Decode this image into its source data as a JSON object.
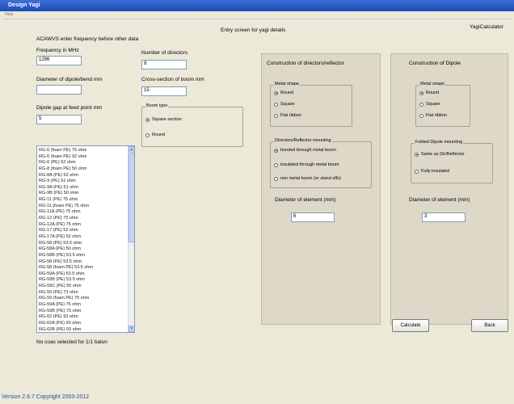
{
  "window": {
    "title": "Design Yagi",
    "menu": "Help"
  },
  "header": {
    "entry_screen": "Entry screen for yagi details",
    "app_name": "YagiCalculator",
    "note": "ACAWVS enter frequency before other data"
  },
  "fields": {
    "frequency": {
      "label": "Frequency in MHz",
      "value": "1296"
    },
    "diameter_dipole": {
      "label": "Diameter of dipole/bend mm",
      "value": ""
    },
    "dipole_gap": {
      "label": "Dipole gap at feed point mm",
      "value": "5"
    },
    "num_directors": {
      "label": "Number of directors",
      "value": "8"
    },
    "boom_cross_section": {
      "label": "Cross-section of boom mm",
      "value": "15"
    }
  },
  "boom_type": {
    "title": "Boom type",
    "options": [
      {
        "label": "Square section",
        "selected": true
      },
      {
        "label": "Round",
        "selected": false
      }
    ]
  },
  "cable_list": {
    "items": [
      "RG-6 (foam PE) 75 ohm",
      "RG-6 (foam PE) 92 ohm",
      "RG-6 (PE) 52 ohm",
      "RG-8 (foam PE) 50 ohm",
      "RG-8A (PE) 52 ohm",
      "RG-9 (PE) 51 ohm",
      "RG-9A (PE) 51 ohm",
      "RG-9B (PE) 50 ohm",
      "RG-11 (PE) 75 ohm",
      "RG-11 (foam PE) 75 ohm",
      "RG-11A (PE) 75 ohm",
      "RG-12 (PE) 75 ohm",
      "RG-12A (PE) 75 ohm",
      "RG-17 (PE) 52 ohm",
      "RG-17A (PE) 52 ohm",
      "RG-58 (PE) 53.5 ohm",
      "RG-58A (PE) 50 ohm",
      "RG-58B (PE) 53.5 ohm",
      "RG-58 (PE) 53.5 ohm",
      "RG-58 (foam PE) 53.5 ohm",
      "RG-59A (PE) 53.5 ohm",
      "RG-59B (PE) 53.5 ohm",
      "RG-59C (PE) 50 ohm",
      "RG-59 (PE) 73 ohm",
      "RG-59 (foam PE) 75 ohm",
      "RG-59A (PE) 75 ohm",
      "RG-59B (PE) 75 ohm",
      "RG-62 (PE) 93 ohm",
      "RG-62A (PE) 93 ohm",
      "RG-62B (PE) 93 ohm"
    ],
    "status": "No coax selected for 1/1 balun"
  },
  "directors_panel": {
    "title": "Construction of directors/reflector",
    "metal_shape": {
      "title": "Metal shape",
      "options": [
        {
          "label": "Round",
          "selected": true
        },
        {
          "label": "Square",
          "selected": false
        },
        {
          "label": "Flat ribbon",
          "selected": false
        }
      ]
    },
    "mounting": {
      "title": "Directors/Reflector mounting",
      "options": [
        {
          "label": "bonded through metal boom",
          "selected": true
        },
        {
          "label": "insulated through metal boom",
          "selected": false
        },
        {
          "label": "non metal boom (or stand offs)",
          "selected": false
        }
      ]
    },
    "diameter": {
      "label": "Diameter of element (mm)",
      "value": "6"
    }
  },
  "dipole_panel": {
    "title": "Construction of Dipole",
    "metal_shape": {
      "title": "Metal shape",
      "options": [
        {
          "label": "Round",
          "selected": true
        },
        {
          "label": "Square",
          "selected": false
        },
        {
          "label": "Flat ribbon",
          "selected": false
        }
      ]
    },
    "mounting": {
      "title": "Folded Dipole mounting",
      "options": [
        {
          "label": "Same as Dir/Reflector",
          "selected": true
        },
        {
          "label": "Fully insulated",
          "selected": false
        }
      ]
    },
    "diameter": {
      "label": "Diameter of element (mm)",
      "value": "3"
    }
  },
  "buttons": {
    "calculate": "Calculate",
    "back": "Back"
  },
  "footer": {
    "version": "Version 2.6.7 Copyright 2003-2012"
  }
}
